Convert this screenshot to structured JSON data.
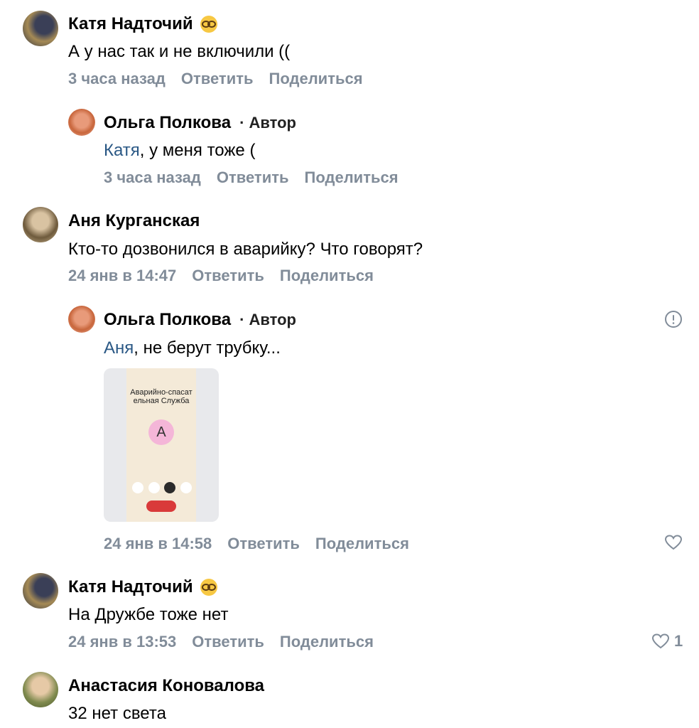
{
  "comments": [
    {
      "author": "Катя Надточий",
      "text": "А у нас так и не включили ((",
      "time": "3 часа назад",
      "reply": "Ответить",
      "share": "Поделиться"
    },
    {
      "author": "Ольга Полкова",
      "author_tag": "· Автор",
      "mention": "Катя",
      "text": ", у меня тоже (",
      "time": "3 часа назад",
      "reply": "Ответить",
      "share": "Поделиться"
    },
    {
      "author": "Аня Курганская",
      "text": "Кто-то дозвонился в аварийку? Что говорят?",
      "time": "24 янв в 14:47",
      "reply": "Ответить",
      "share": "Поделиться"
    },
    {
      "author": "Ольга Полкова",
      "author_tag": "· Автор",
      "mention": "Аня",
      "text": ", не берут трубку...",
      "attachment_title": "Аварийно-спасат ельная Служба",
      "attachment_letter": "А",
      "time": "24 янв в 14:58",
      "reply": "Ответить",
      "share": "Поделиться",
      "likes": "",
      "icons": [
        "report-icon",
        "heart-icon"
      ]
    },
    {
      "author": "Катя Надточий",
      "text": "На Дружбе тоже нет",
      "time": "24 янв в 13:53",
      "reply": "Ответить",
      "share": "Поделиться",
      "likes": "1",
      "icons": [
        "heart-icon"
      ]
    },
    {
      "author": "Анастасия Коновалова",
      "text": "32 нет света"
    }
  ],
  "colors": {
    "meta": "#818c99",
    "mention": "#2a5885",
    "end_call": "#d93a3a"
  }
}
